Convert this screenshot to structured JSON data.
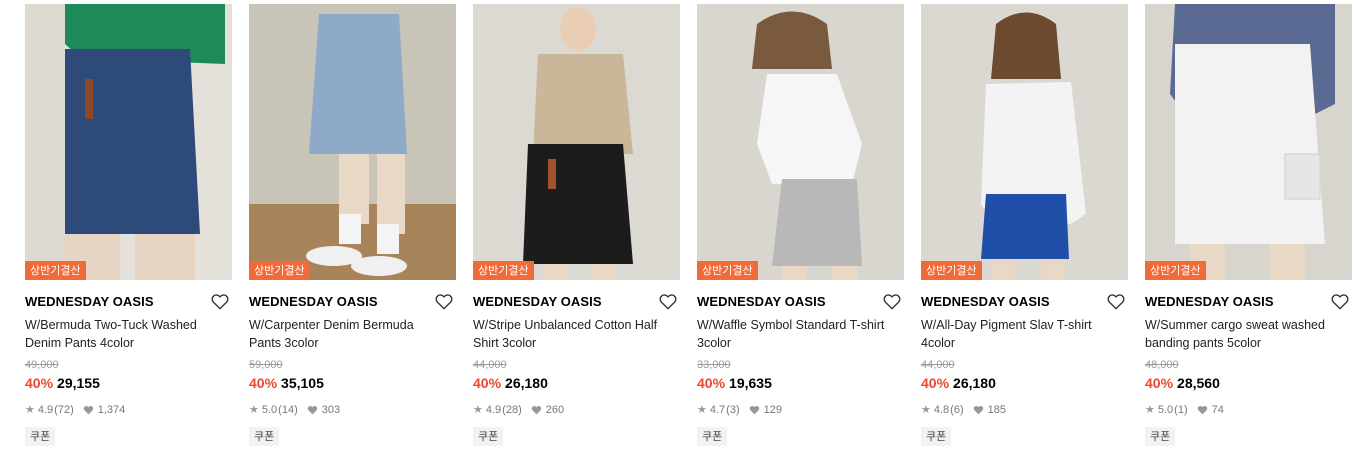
{
  "badge_label": "상반기결산",
  "coupon_label": "쿠폰",
  "colors": {
    "accent": "#f0462d",
    "badge": "#f06a3a"
  },
  "products": [
    {
      "brand": "WEDNESDAY OASIS",
      "name": "W/Bermuda Two-Tuck Washed Denim Pants 4color",
      "original_price": "49,000",
      "discount": "40%",
      "price": "29,155",
      "rating": "4.9",
      "reviews": "(72)",
      "likes": "1,374"
    },
    {
      "brand": "WEDNESDAY OASIS",
      "name": "W/Carpenter Denim Bermuda Pants 3color",
      "original_price": "59,000",
      "discount": "40%",
      "price": "35,105",
      "rating": "5.0",
      "reviews": "(14)",
      "likes": "303"
    },
    {
      "brand": "WEDNESDAY OASIS",
      "name": "W/Stripe Unbalanced Cotton Half Shirt 3color",
      "original_price": "44,000",
      "discount": "40%",
      "price": "26,180",
      "rating": "4.9",
      "reviews": "(28)",
      "likes": "260"
    },
    {
      "brand": "WEDNESDAY OASIS",
      "name": "W/Waffle Symbol Standard T-shirt 3color",
      "original_price": "33,000",
      "discount": "40%",
      "price": "19,635",
      "rating": "4.7",
      "reviews": "(3)",
      "likes": "129"
    },
    {
      "brand": "WEDNESDAY OASIS",
      "name": "W/All-Day Pigment Slav T-shirt 4color",
      "original_price": "44,000",
      "discount": "40%",
      "price": "26,180",
      "rating": "4.8",
      "reviews": "(6)",
      "likes": "185"
    },
    {
      "brand": "WEDNESDAY OASIS",
      "name": "W/Summer cargo sweat washed banding pants 5color",
      "original_price": "48,000",
      "discount": "40%",
      "price": "28,560",
      "rating": "5.0",
      "reviews": "(1)",
      "likes": "74"
    }
  ]
}
